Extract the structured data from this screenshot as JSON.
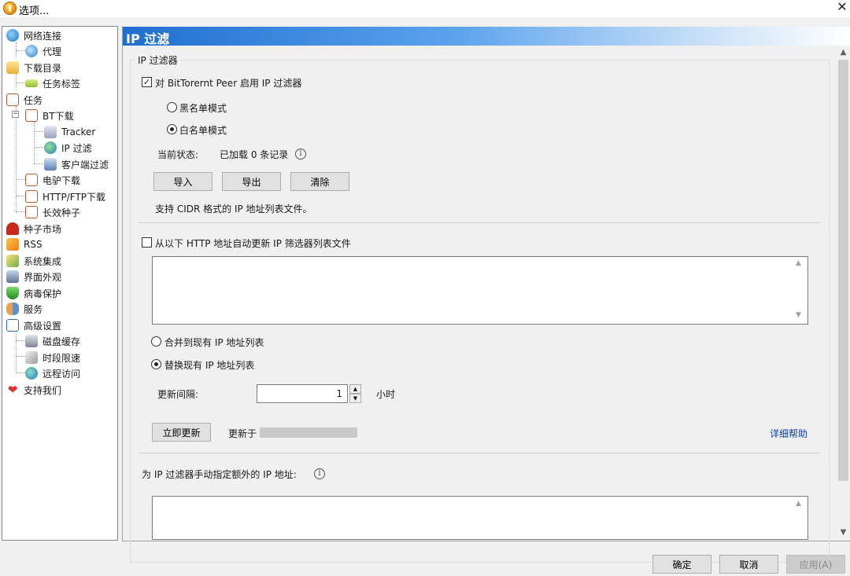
{
  "window": {
    "title": "选项..."
  },
  "sidebar": {
    "items": [
      {
        "label": "网络连接",
        "icon": "globe-network-icon"
      },
      {
        "label": "代理",
        "icon": "proxy-globe-icon"
      },
      {
        "label": "下载目录",
        "icon": "folder-open-icon"
      },
      {
        "label": "任务标签",
        "icon": "tag-icon"
      },
      {
        "label": "任务",
        "icon": "task-icon"
      },
      {
        "label": "BT下载",
        "icon": "task-icon"
      },
      {
        "label": "Tracker",
        "icon": "tracker-server-icon"
      },
      {
        "label": "IP 过滤",
        "icon": "ip-filter-globe-icon"
      },
      {
        "label": "客户端过滤",
        "icon": "client-network-icon"
      },
      {
        "label": "电驴下载",
        "icon": "task-icon"
      },
      {
        "label": "HTTP/FTP下载",
        "icon": "task-icon"
      },
      {
        "label": "长效种子",
        "icon": "task-icon"
      },
      {
        "label": "种子市场",
        "icon": "magnet-icon"
      },
      {
        "label": "RSS",
        "icon": "rss-icon"
      },
      {
        "label": "系统集成",
        "icon": "system-integration-icon"
      },
      {
        "label": "界面外观",
        "icon": "appearance-icon"
      },
      {
        "label": "病毒保护",
        "icon": "shield-icon"
      },
      {
        "label": "服务",
        "icon": "users-icon"
      },
      {
        "label": "高级设置",
        "icon": "advanced-settings-icon"
      },
      {
        "label": "磁盘缓存",
        "icon": "disk-cache-icon"
      },
      {
        "label": "时段限速",
        "icon": "time-limit-icon"
      },
      {
        "label": "远程访问",
        "icon": "remote-globe-icon"
      },
      {
        "label": "支持我们",
        "icon": "heart-icon"
      }
    ]
  },
  "panel": {
    "title": "IP 过滤",
    "group_label": "IP 过滤器",
    "enable_checkbox": {
      "label": "对 BitTorernt Peer 启用 IP 过滤器",
      "checked": true
    },
    "mode_blacklist": "黑名单模式",
    "mode_whitelist": "白名单模式",
    "status_label": "当前状态:",
    "status_value": "已加载 0 条记录",
    "import_button": "导入",
    "export_button": "导出",
    "clear_button": "清除",
    "cidr_note": "支持 CIDR 格式的 IP 地址列表文件。",
    "auto_update_checkbox": {
      "label": "从以下 HTTP 地址自动更新 IP 筛选器列表文件",
      "checked": false
    },
    "url_list_value": "",
    "merge_radio": "合并到现有 IP 地址列表",
    "replace_radio": "替换现有 IP 地址列表",
    "interval_label": "更新间隔:",
    "interval_value": "1",
    "interval_unit": "小时",
    "update_now_button": "立即更新",
    "updated_at_label": "更新于",
    "help_link": "详细帮助",
    "manual_label": "为 IP 过滤器手动指定额外的 IP 地址:",
    "manual_value": ""
  },
  "footer": {
    "ok_button": "确定",
    "cancel_button": "取消",
    "apply_button": "应用(A)"
  },
  "colors": {
    "header_start": "#1f6fd1",
    "header_end": "#ffffff",
    "link": "#0b3fa8"
  }
}
